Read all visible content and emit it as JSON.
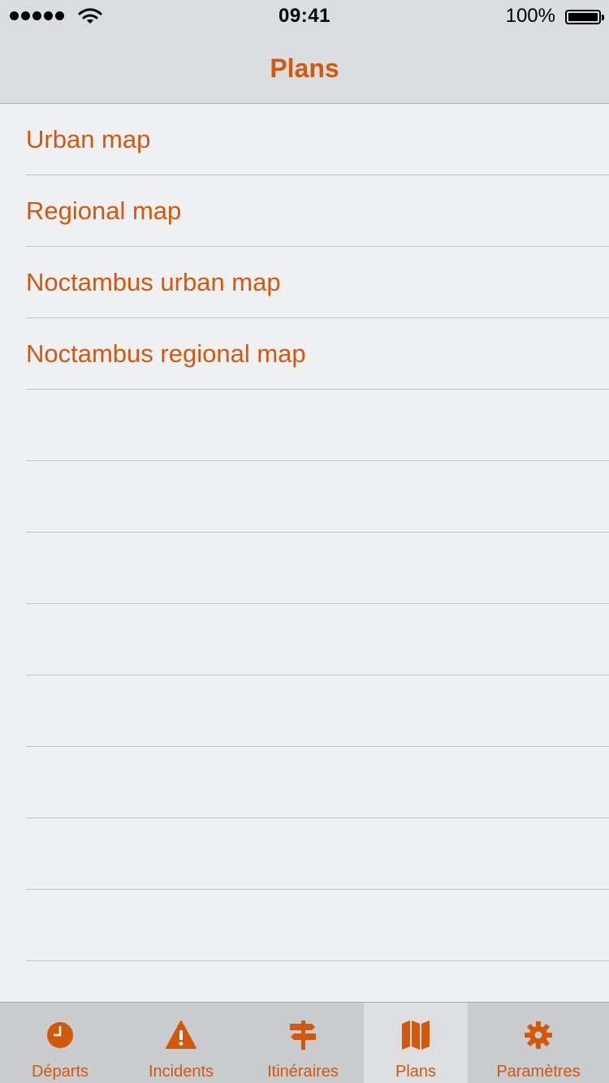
{
  "status_bar": {
    "time": "09:41",
    "battery": "100%",
    "icons": [
      "signal-dots-icon",
      "wifi-icon",
      "battery-icon"
    ]
  },
  "nav": {
    "title": "Plans"
  },
  "list": {
    "items": [
      {
        "label": "Urban map"
      },
      {
        "label": "Regional map"
      },
      {
        "label": "Noctambus urban map"
      },
      {
        "label": "Noctambus regional map"
      }
    ]
  },
  "tabbar": {
    "tabs": [
      {
        "label": "Départs",
        "icon": "clock-icon"
      },
      {
        "label": "Incidents",
        "icon": "warning-icon"
      },
      {
        "label": "Itinéraires",
        "icon": "signpost-icon"
      },
      {
        "label": "Plans",
        "icon": "map-icon",
        "selected": true
      },
      {
        "label": "Paramètres",
        "icon": "gear-icon"
      }
    ]
  },
  "colors": {
    "accent": "#d2580d",
    "background": "#eef0f1",
    "navbar": "#dadddf",
    "tabbar": "#c9cbcd",
    "tab_selected": "#dcdee0"
  }
}
